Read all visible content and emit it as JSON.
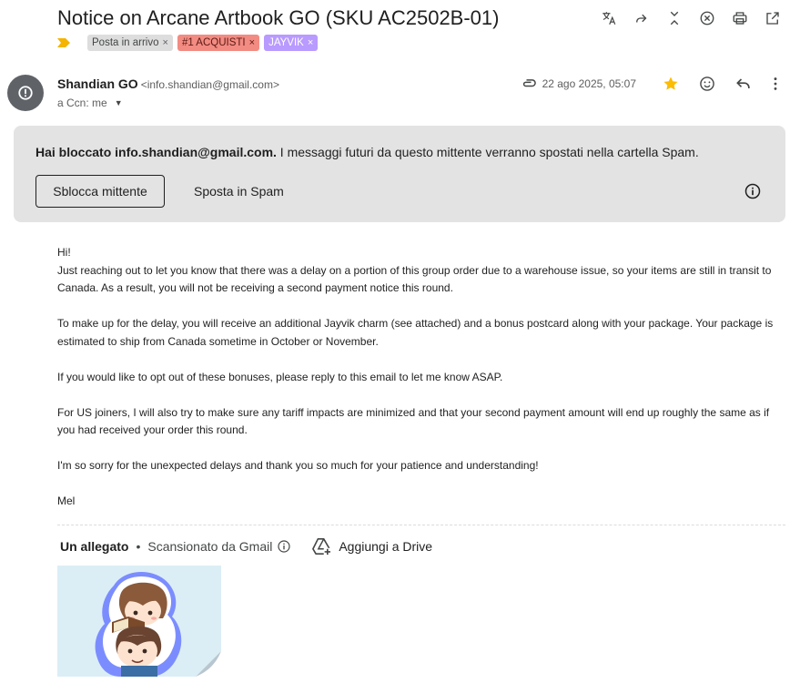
{
  "subject": "Notice on Arcane Artbook GO (SKU AC2502B-01)",
  "labels": [
    {
      "name": "Posta in arrivo",
      "color": "#dddddd"
    },
    {
      "name": "#1 ACQUISTI",
      "color": "#f28b82"
    },
    {
      "name": "JAYVIK",
      "color": "#b99aff"
    }
  ],
  "label_remove_glyph": "×",
  "toolbar_icons": [
    "translate-icon",
    "forward-all-icon",
    "collapse-icon",
    "block-icon",
    "print-icon",
    "open-in-new-window-icon"
  ],
  "sender": {
    "name": "Shandian GO",
    "email": "<info.shandian@gmail.com>",
    "recipient": "a Ccn: me",
    "date": "22 ago 2025, 05:07",
    "starred": true,
    "star_color": "#fbbc04"
  },
  "banner": {
    "bold_text": "Hai bloccato info.shandian@gmail.com.",
    "text": " I messaggi futuri da questo mittente verranno spostati nella cartella Spam.",
    "unblock_label": "Sblocca mittente",
    "spam_label": "Sposta in Spam"
  },
  "body": {
    "greeting": "Hi!",
    "p1": "Just reaching out to let you know that there was a delay on a portion of this group order due to a warehouse issue, so your items are still in transit to Canada. As a result, you will not be receiving a second payment notice this round.",
    "p2": "To make up for the delay, you will receive an additional Jayvik charm (see attached) and a bonus postcard along with your package. Your package is estimated to ship from Canada sometime in October or November.",
    "p3": "If you would like to opt out of these bonuses, please reply to this email to let me know ASAP.",
    "p4": "For US joiners, I will also try to make sure any tariff impacts are minimized and that your second payment amount will end up roughly the same as if you had received your order this round.",
    "p5": "I'm so sorry for the unexpected delays and thank you so much for your patience and understanding!",
    "signature": "Mel"
  },
  "attachments": {
    "title": "Un allegato",
    "separator": "•",
    "scanned": "Scansionato da Gmail",
    "drive_label": "Aggiungi a Drive"
  }
}
